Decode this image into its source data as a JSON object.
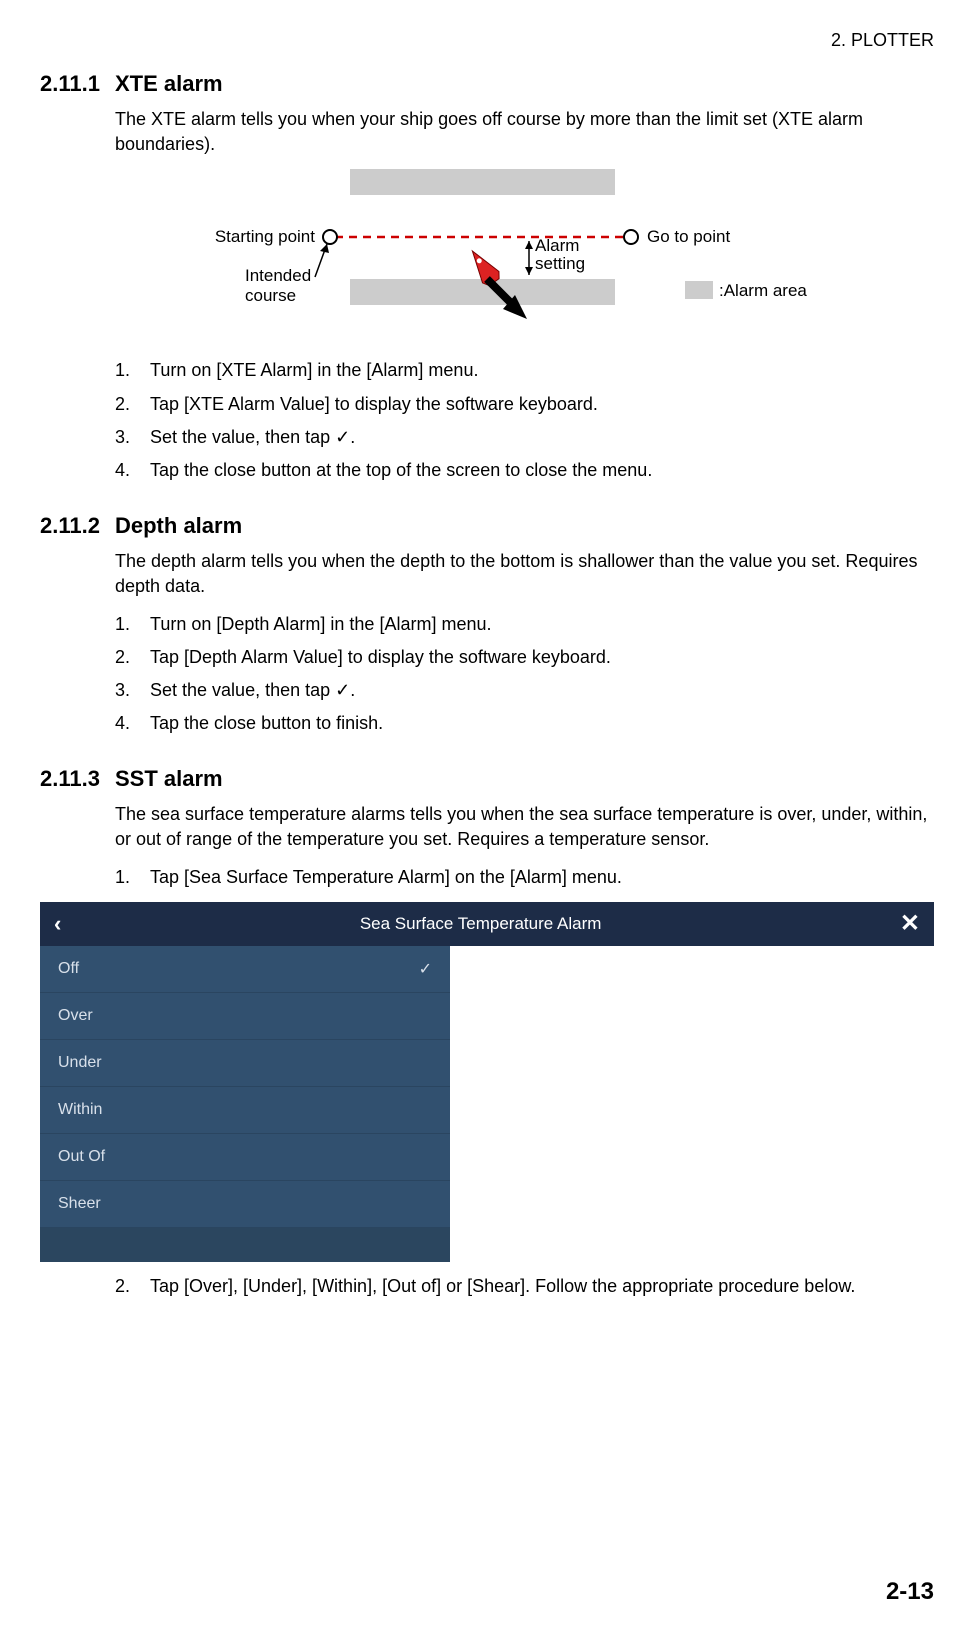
{
  "header": {
    "chapter": "2.  PLOTTER"
  },
  "footer": {
    "pageNumber": "2-13"
  },
  "xte": {
    "number": "2.11.1",
    "title": "XTE alarm",
    "intro": "The XTE alarm tells you when your ship goes off course by more than the limit set (XTE alarm boundaries).",
    "diagram": {
      "startingPoint": "Starting point",
      "goToPoint": "Go to point",
      "alarmSetting": "Alarm",
      "alarmSetting2": "setting",
      "intendedCourse1": "Intended",
      "intendedCourse2": "course",
      "alarmArea": ":Alarm area"
    },
    "steps": [
      "Turn on [XTE Alarm] in the [Alarm] menu.",
      "Tap [XTE Alarm Value] to display the software keyboard.",
      "Set the value, then tap ✓.",
      "Tap the close button at the top of the screen to close the menu."
    ]
  },
  "depth": {
    "number": "2.11.2",
    "title": "Depth alarm",
    "intro": "The depth alarm tells you when the depth to the bottom is shallower than the value you set. Requires depth data.",
    "steps": [
      "Turn on [Depth Alarm] in the [Alarm] menu.",
      "Tap [Depth Alarm Value] to display the software keyboard.",
      "Set the value, then tap ✓.",
      "Tap the close button to finish."
    ]
  },
  "sst": {
    "number": "2.11.3",
    "title": "SST alarm",
    "intro": "The sea surface temperature alarms tells you when the sea surface temperature is over, under, within, or out of range of the temperature you set. Requires a temperature sensor.",
    "step1": "Tap [Sea Surface Temperature Alarm] on the [Alarm] menu.",
    "step2": "Tap [Over], [Under], [Within], [Out of] or [Shear]. Follow the appropriate procedure below.",
    "screenshot": {
      "title": "Sea Surface Temperature Alarm",
      "back": "‹",
      "close": "✕",
      "options": [
        "Off",
        "Over",
        "Under",
        "Within",
        "Out Of",
        "Sheer"
      ],
      "selectedIndex": 0,
      "check": "✓"
    }
  }
}
